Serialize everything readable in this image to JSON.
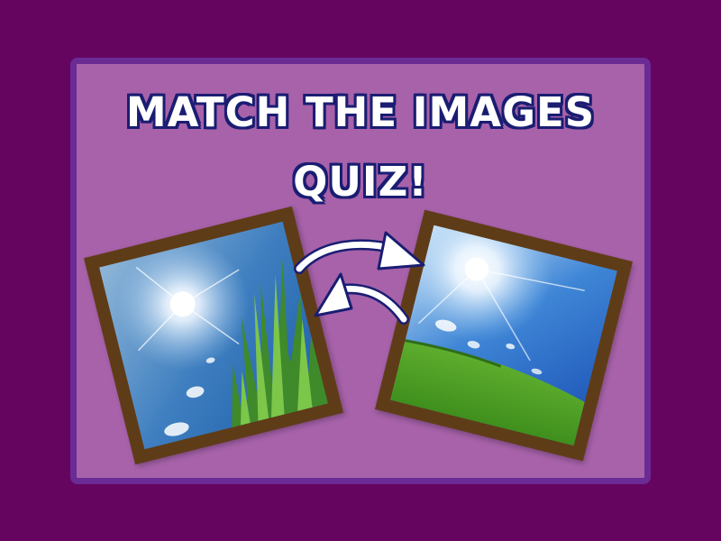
{
  "title": {
    "line1": "MATCH THE IMAGES",
    "line2": "QUIZ!"
  },
  "images": [
    {
      "subject": "sun in blue sky behind tall green grass blades"
    },
    {
      "subject": "sun in blue sky above green grass field"
    }
  ],
  "arrows": {
    "icon": "swap-arrows-icon"
  },
  "colors": {
    "background": "#650560",
    "card": "#a762aa",
    "card_border": "#6b2b95",
    "frame": "#5f3c18",
    "title_fill": "#ffffff",
    "title_outline": "#1a1d72"
  }
}
